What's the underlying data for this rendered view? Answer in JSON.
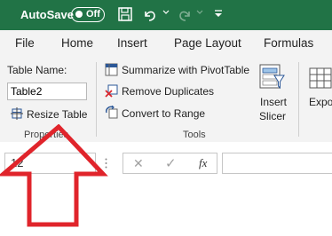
{
  "titlebar": {
    "autosave_label": "AutoSave",
    "autosave_state": "Off",
    "icons": [
      "save-icon",
      "undo-icon",
      "undo-dropdown-icon",
      "redo-icon",
      "redo-dropdown-icon",
      "customize-quick-access-icon"
    ]
  },
  "tabs": [
    {
      "label": "File"
    },
    {
      "label": "Home"
    },
    {
      "label": "Insert"
    },
    {
      "label": "Page Layout"
    },
    {
      "label": "Formulas"
    }
  ],
  "ribbon": {
    "properties": {
      "table_name_label": "Table Name:",
      "table_name_value": "Table2",
      "resize_label": "Resize Table",
      "group_label": "Properties"
    },
    "tools": {
      "summarize_label": "Summarize with PivotTable",
      "remove_duplicates_label": "Remove Duplicates",
      "convert_label": "Convert to Range",
      "group_label": "Tools"
    },
    "insert_slicer": {
      "line1": "Insert",
      "line2": "Slicer"
    },
    "export": {
      "label": "Expo"
    }
  },
  "formula_bar": {
    "name_box_value": "12",
    "cancel_symbol": "✕",
    "enter_symbol": "✓",
    "fx_symbol": "fx",
    "formula_value": ""
  },
  "annotation": {
    "arrow": "red-up-arrow",
    "color": "#e0242b"
  },
  "colors": {
    "excel_green": "#217346",
    "ribbon_bg": "#f3f3f3",
    "arrow_red": "#e0242b"
  }
}
